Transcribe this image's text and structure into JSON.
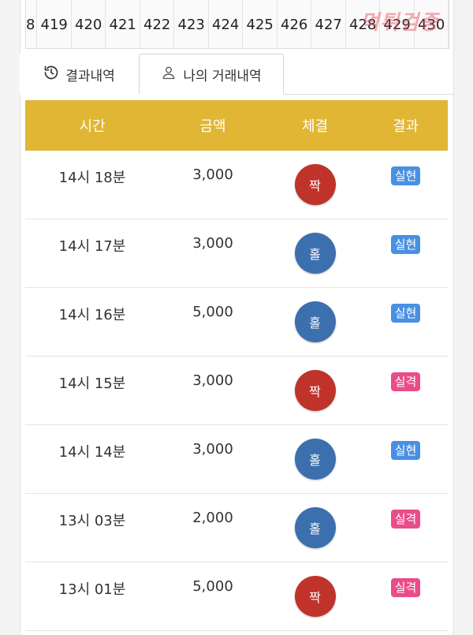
{
  "number_strip": [
    "8",
    "419",
    "420",
    "421",
    "422",
    "423",
    "424",
    "425",
    "426",
    "427",
    "428",
    "429",
    "430"
  ],
  "watermark": "먹튀검증",
  "tabs": [
    {
      "label": "결과내역",
      "icon": "history-icon"
    },
    {
      "label": "나의 거래내역",
      "icon": "user-icon",
      "active": true
    }
  ],
  "table": {
    "headers": [
      "시간",
      "금액",
      "체결",
      "결과"
    ],
    "rows": [
      {
        "time": "14시 18분",
        "amount": "3,000",
        "pick": "짝",
        "pick_type": "even",
        "result": "실현",
        "result_type": "win"
      },
      {
        "time": "14시 17분",
        "amount": "3,000",
        "pick": "홀",
        "pick_type": "odd",
        "result": "실현",
        "result_type": "win"
      },
      {
        "time": "14시 16분",
        "amount": "5,000",
        "pick": "홀",
        "pick_type": "odd",
        "result": "실현",
        "result_type": "win"
      },
      {
        "time": "14시 15분",
        "amount": "3,000",
        "pick": "짝",
        "pick_type": "even",
        "result": "실격",
        "result_type": "lose"
      },
      {
        "time": "14시 14분",
        "amount": "3,000",
        "pick": "홀",
        "pick_type": "odd",
        "result": "실현",
        "result_type": "win"
      },
      {
        "time": "13시 03분",
        "amount": "2,000",
        "pick": "홀",
        "pick_type": "odd",
        "result": "실격",
        "result_type": "lose"
      },
      {
        "time": "13시 01분",
        "amount": "5,000",
        "pick": "짝",
        "pick_type": "even",
        "result": "실격",
        "result_type": "lose"
      }
    ]
  },
  "colors": {
    "header_bg": "#e0b634",
    "even_ball": "#c0332b",
    "odd_ball": "#3c6fae",
    "win_badge": "#4a90e2",
    "lose_badge": "#ea4c89"
  }
}
